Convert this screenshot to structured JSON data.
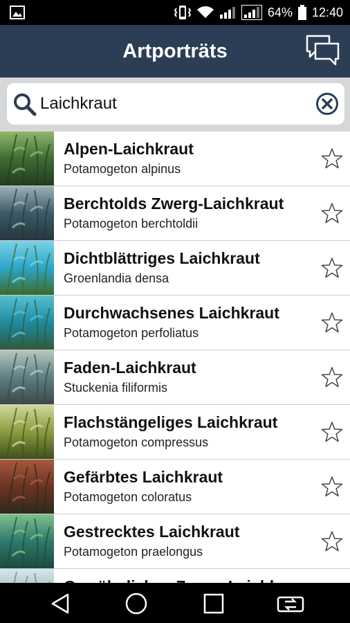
{
  "status_bar": {
    "battery_percent": "64%",
    "time": "12:40",
    "icons": [
      "image-icon",
      "vibrate-icon",
      "wifi-icon",
      "signal-icon",
      "signal-icon",
      "battery-icon"
    ]
  },
  "app_bar": {
    "title": "Artporträts",
    "chat_icon": "chat-bubbles-icon"
  },
  "search": {
    "value": "Laichkraut",
    "search_icon": "search-icon",
    "clear_icon": "clear-icon"
  },
  "species": [
    {
      "name": "Alpen-Laichkraut",
      "latin": "Potamogeton alpinus",
      "thumb_colors": [
        "#3f6b34",
        "#8fb86a",
        "#223c1f"
      ]
    },
    {
      "name": "Berchtolds Zwerg-Laichkraut",
      "latin": "Potamogeton berchtoldii",
      "thumb_colors": [
        "#3c5a66",
        "#9bb2b8",
        "#26363d"
      ]
    },
    {
      "name": "Dichtblättriges Laichkraut",
      "latin": "Groenlandia densa",
      "thumb_colors": [
        "#2aa7c9",
        "#79d2e8",
        "#3e6a2b"
      ]
    },
    {
      "name": "Durchwachsenes Laichkraut",
      "latin": "Potamogeton perfoliatus",
      "thumb_colors": [
        "#1f8aa0",
        "#54c1cf",
        "#2f5a3c"
      ]
    },
    {
      "name": "Faden-Laichkraut",
      "latin": "Stuckenia filiformis",
      "thumb_colors": [
        "#5d7f86",
        "#b8c6c0",
        "#3b4a44"
      ]
    },
    {
      "name": "Flachstängeliges Laichkraut",
      "latin": "Potamogeton compressus",
      "thumb_colors": [
        "#8a9b3f",
        "#d1d89a",
        "#3e4f1d"
      ]
    },
    {
      "name": "Gefärbtes Laichkraut",
      "latin": "Potamogeton coloratus",
      "thumb_colors": [
        "#6b3324",
        "#a65a3b",
        "#2e2a1d"
      ]
    },
    {
      "name": "Gestrecktes Laichkraut",
      "latin": "Potamogeton praelongus",
      "thumb_colors": [
        "#2e7a6d",
        "#7fbf8a",
        "#1c4a3d"
      ]
    },
    {
      "name": "Gewöhnliches Zwerg-Laichkr",
      "latin": "",
      "thumb_colors": [
        "#9fb9c2",
        "#d8e6ea",
        "#6b8790"
      ]
    }
  ],
  "nav_bar": {
    "icons": [
      "back-icon",
      "home-icon",
      "recents-icon",
      "screen-switch-icon"
    ]
  }
}
